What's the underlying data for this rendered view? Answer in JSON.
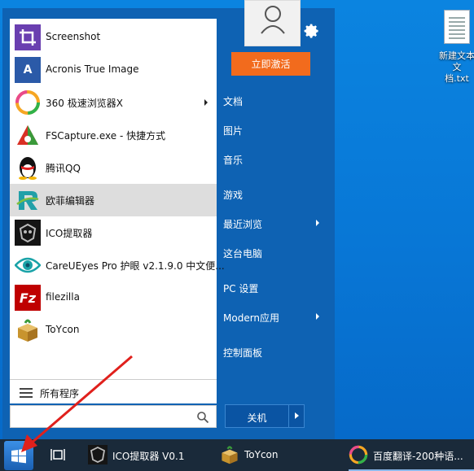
{
  "desktop": {
    "file_label": "新建文本文\n档.txt"
  },
  "start_menu": {
    "apps": [
      {
        "label": "Screenshot",
        "icon": "crop-icon",
        "color": "#6a3fb0"
      },
      {
        "label": "Acronis True Image",
        "icon": "acronis-icon",
        "color": "#2b5aa8"
      },
      {
        "label": "360 极速浏览器X",
        "icon": "browser-360-icon",
        "has_submenu": true
      },
      {
        "label": "FSCapture.exe - 快捷方式",
        "icon": "fscapture-icon"
      },
      {
        "label": "腾讯QQ",
        "icon": "qq-penguin-icon"
      },
      {
        "label": "欧菲编辑器",
        "icon": "ofei-editor-icon",
        "selected": true
      },
      {
        "label": "ICO提取器",
        "icon": "ico-extractor-icon"
      },
      {
        "label": "CareUEyes Pro 护眼 v2.1.9.0 中文便...",
        "icon": "eye-icon"
      },
      {
        "label": "filezilla",
        "icon": "filezilla-icon"
      },
      {
        "label": "ToYcon",
        "icon": "toycon-box-icon"
      }
    ],
    "all_programs": "所有程序",
    "search_placeholder": "",
    "activate_button": "立即激活",
    "places": [
      {
        "label": "文档"
      },
      {
        "label": "图片"
      },
      {
        "label": "音乐"
      },
      {
        "label": "游戏"
      },
      {
        "label": "最近浏览",
        "has_submenu": true
      },
      {
        "label": "这台电脑"
      },
      {
        "label": "PC 设置"
      },
      {
        "label": "Modern应用",
        "has_submenu": true
      },
      {
        "label": "控制面板"
      }
    ],
    "shutdown_label": "关机"
  },
  "taskbar": {
    "items": [
      {
        "label": "ICO提取器 V0.1",
        "icon": "ico-extractor-icon"
      },
      {
        "label": "ToYcon",
        "icon": "toycon-box-icon"
      },
      {
        "label": "百度翻译-200种语...",
        "icon": "browser-360-icon"
      }
    ]
  },
  "colors": {
    "menu_bg": "#0e62b3",
    "accent": "#f26b1d",
    "annotation": "#e0201c"
  }
}
